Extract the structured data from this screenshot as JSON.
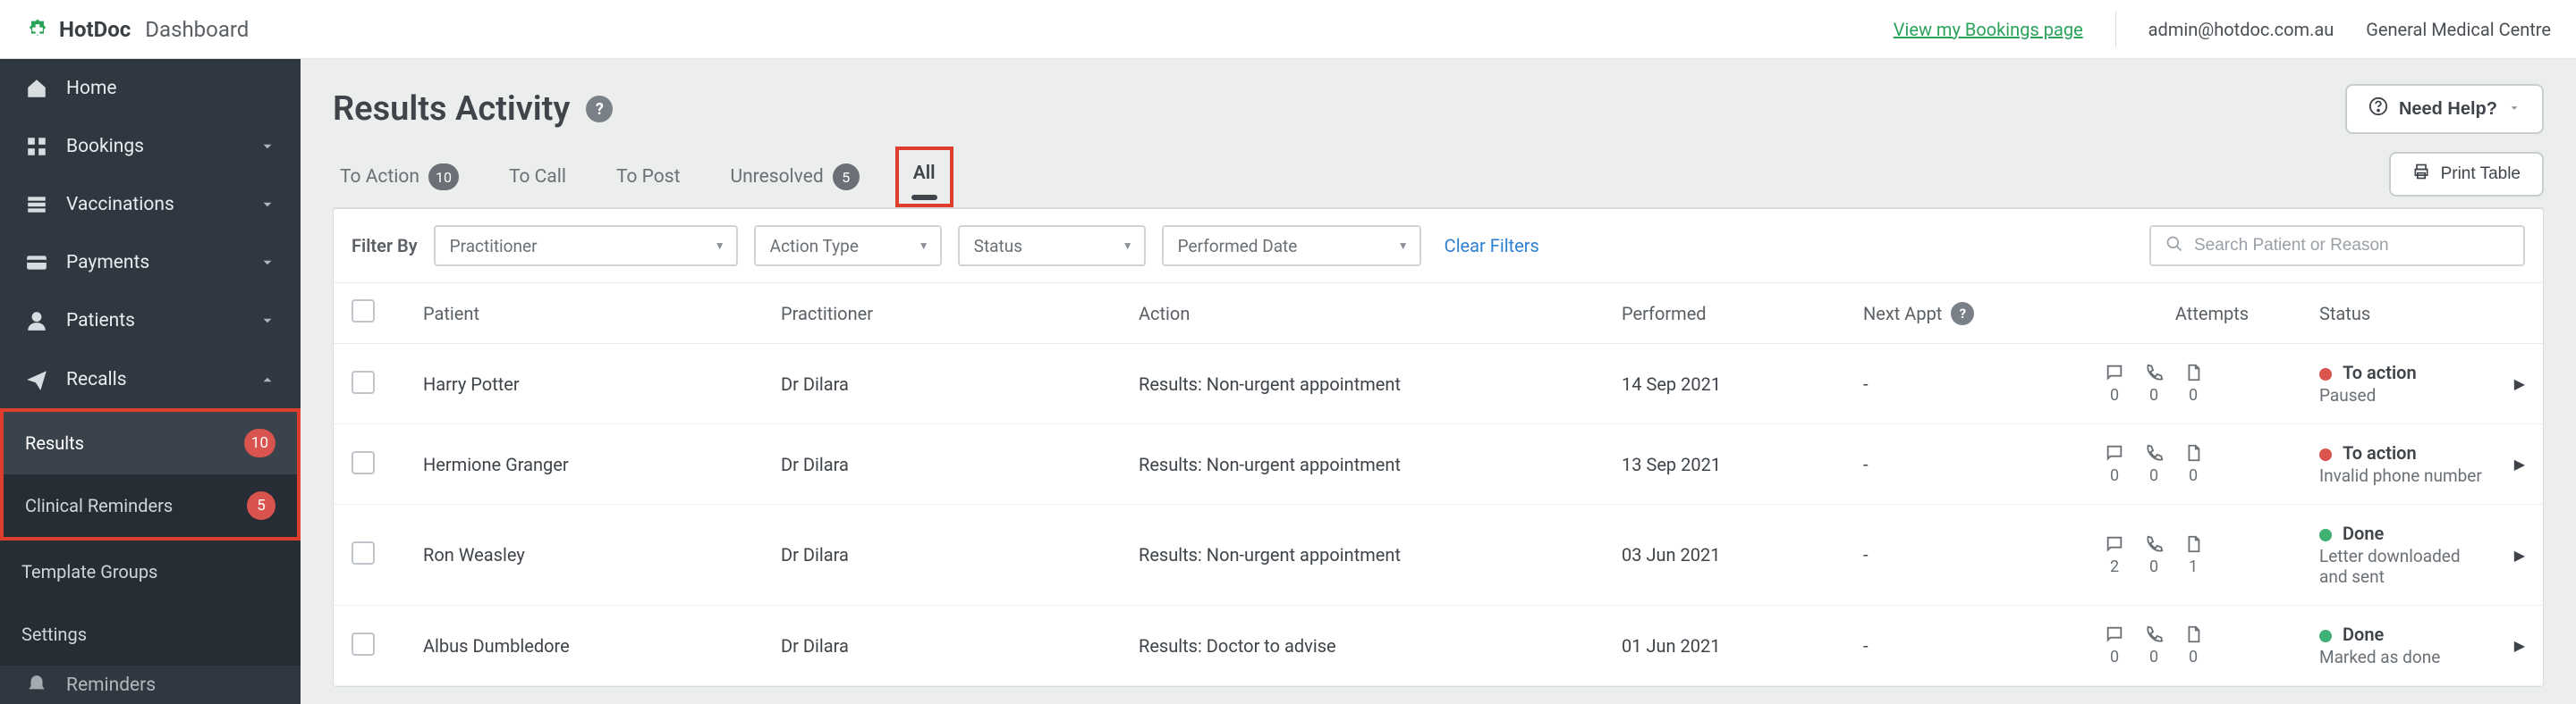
{
  "brand": {
    "name": "HotDoc",
    "sub": "Dashboard"
  },
  "topbar": {
    "bookings_link": "View my Bookings page",
    "email": "admin@hotdoc.com.au",
    "org": "General Medical Centre"
  },
  "sidebar": {
    "items": [
      {
        "label": "Home",
        "icon": "home"
      },
      {
        "label": "Bookings",
        "icon": "grid",
        "chev": "down"
      },
      {
        "label": "Vaccinations",
        "icon": "stack",
        "chev": "down"
      },
      {
        "label": "Payments",
        "icon": "card",
        "chev": "down"
      },
      {
        "label": "Patients",
        "icon": "user",
        "chev": "down"
      },
      {
        "label": "Recalls",
        "icon": "send",
        "chev": "up"
      }
    ],
    "recalls_sub": [
      {
        "label": "Results",
        "badge": "10",
        "active": true
      },
      {
        "label": "Clinical Reminders",
        "badge": "5"
      },
      {
        "label": "Template Groups"
      },
      {
        "label": "Settings"
      }
    ],
    "reminders_icon": "bell",
    "reminders_label": "Reminders"
  },
  "page": {
    "title": "Results Activity",
    "need_help": "Need Help?",
    "print": "Print Table"
  },
  "tabs": [
    {
      "label": "To Action",
      "count": "10"
    },
    {
      "label": "To Call"
    },
    {
      "label": "To Post"
    },
    {
      "label": "Unresolved",
      "count": "5"
    },
    {
      "label": "All",
      "active": true
    }
  ],
  "filters": {
    "label": "Filter By",
    "practitioner": "Practitioner",
    "action_type": "Action Type",
    "status": "Status",
    "performed_date": "Performed Date",
    "clear": "Clear Filters",
    "search_placeholder": "Search Patient or Reason"
  },
  "columns": {
    "patient": "Patient",
    "practitioner": "Practitioner",
    "action": "Action",
    "performed": "Performed",
    "next_appt": "Next Appt",
    "attempts": "Attempts",
    "status": "Status"
  },
  "rows": [
    {
      "patient": "Harry Potter",
      "practitioner": "Dr Dilara",
      "action": "Results: Non-urgent appointment",
      "performed": "14 Sep 2021",
      "next": "-",
      "att_sms": "0",
      "att_phone": "0",
      "att_doc": "0",
      "status_main": "To action",
      "status_sub": "Paused",
      "dot": "red"
    },
    {
      "patient": "Hermione Granger",
      "practitioner": "Dr Dilara",
      "action": "Results: Non-urgent appointment",
      "performed": "13 Sep 2021",
      "next": "-",
      "att_sms": "0",
      "att_phone": "0",
      "att_doc": "0",
      "status_main": "To action",
      "status_sub": "Invalid phone number",
      "dot": "red"
    },
    {
      "patient": "Ron Weasley",
      "practitioner": "Dr Dilara",
      "action": "Results: Non-urgent appointment",
      "performed": "03 Jun 2021",
      "next": "-",
      "att_sms": "2",
      "att_phone": "0",
      "att_doc": "1",
      "status_main": "Done",
      "status_sub": "Letter downloaded and sent",
      "dot": "green"
    },
    {
      "patient": "Albus Dumbledore",
      "practitioner": "Dr Dilara",
      "action": "Results: Doctor to advise",
      "performed": "01 Jun 2021",
      "next": "-",
      "att_sms": "0",
      "att_phone": "0",
      "att_doc": "0",
      "status_main": "Done",
      "status_sub": "Marked as done",
      "dot": "green"
    }
  ]
}
